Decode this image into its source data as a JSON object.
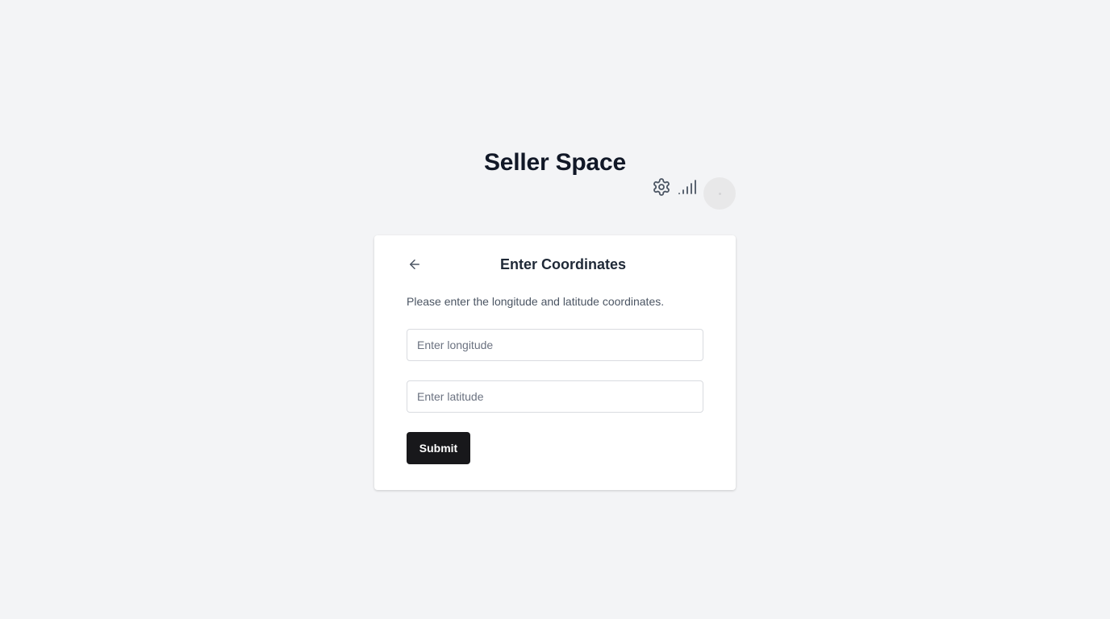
{
  "header": {
    "title": "Seller Space",
    "icons": [
      "gear-icon",
      "signal-icon"
    ],
    "avatar": "avatar"
  },
  "card": {
    "back_icon": "arrow-left-icon",
    "title": "Enter Coordinates",
    "description": "Please enter the longitude and latitude coordinates.",
    "longitude": {
      "value": "",
      "placeholder": "Enter longitude"
    },
    "latitude": {
      "value": "",
      "placeholder": "Enter latitude"
    },
    "submit_label": "Submit"
  },
  "colors": {
    "background": "#f3f4f6",
    "card": "#ffffff",
    "primary_button": "#18181b",
    "title_text": "#111827",
    "muted_text": "#4b5563"
  }
}
